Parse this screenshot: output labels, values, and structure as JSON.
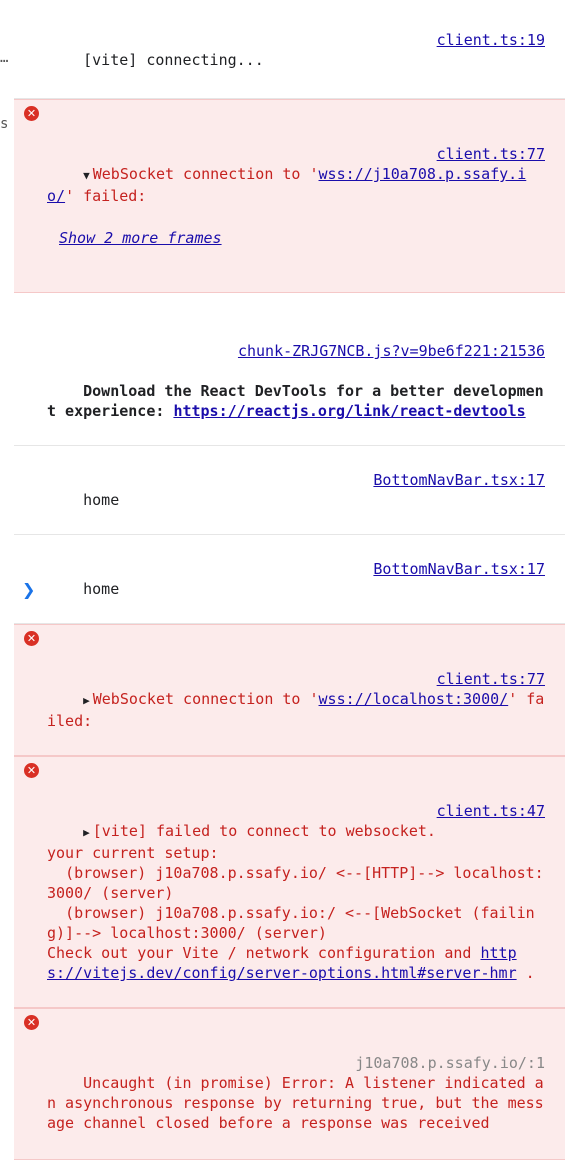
{
  "gutter": {
    "frag1": "…",
    "frag2": "s"
  },
  "messages": [
    {
      "text": "[vite] connecting...",
      "source": "client.ts:19"
    },
    {
      "text_pre": "WebSocket connection to '",
      "link": "wss://j10a708.p.ssafy.io/",
      "text_post": "' failed:",
      "source": "client.ts:77",
      "frames_link": "Show 2 more frames"
    },
    {
      "source": "chunk-ZRJG7NCB.js?v=9be6f221:21536",
      "text": "Download the React DevTools for a better development experience: ",
      "link": "https://reactjs.org/link/react-devtools"
    },
    {
      "text": "home",
      "source": "BottomNavBar.tsx:17"
    },
    {
      "text": "home",
      "source": "BottomNavBar.tsx:17"
    },
    {
      "text_pre": "WebSocket connection to '",
      "link": "wss://localhost:3000/",
      "text_post": "' failed:",
      "source": "client.ts:77"
    },
    {
      "text": "[vite] failed to connect to websocket.\nyour current setup:\n  (browser) j10a708.p.ssafy.io/ <--[HTTP]--> localhost:3000/ (server)\n  (browser) j10a708.p.ssafy.io:/ <--[WebSocket (failing)]--> localhost:3000/ (server)\nCheck out your Vite / network configuration and ",
      "link": "https://vitejs.dev/config/server-options.html#server-hmr",
      "text_post": " .",
      "source": "client.ts:47"
    },
    {
      "text": "Uncaught (in promise) Error: A listener indicated an asynchronous response by returning true, but the message channel closed before a response was received",
      "source": "j10a708.p.ssafy.io/:1"
    }
  ],
  "prompt_symbol": "❯"
}
